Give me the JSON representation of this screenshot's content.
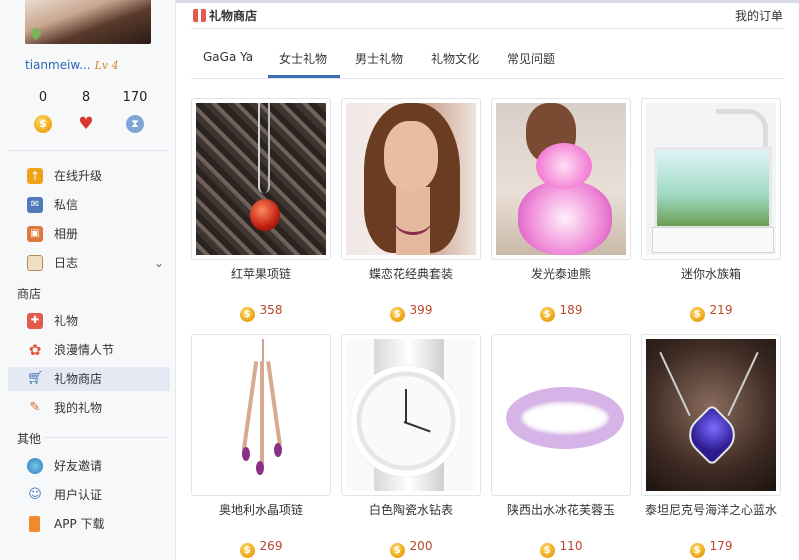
{
  "user": {
    "name": "tianmeiw...",
    "level": "Lv 4",
    "stats": [
      {
        "value": "0",
        "icon": "coin-icon"
      },
      {
        "value": "8",
        "icon": "heart-icon"
      },
      {
        "value": "170",
        "icon": "hourglass-icon"
      }
    ]
  },
  "sidebar": {
    "items_top": [
      {
        "label": "在线升级",
        "icon": "upgrade-icon"
      },
      {
        "label": "私信",
        "icon": "mail-icon"
      },
      {
        "label": "相册",
        "icon": "album-icon"
      },
      {
        "label": "日志",
        "icon": "journal-icon"
      }
    ],
    "section_shop": "商店",
    "items_shop": [
      {
        "label": "礼物",
        "icon": "gift-icon"
      },
      {
        "label": "浪漫情人节",
        "icon": "flower-icon"
      },
      {
        "label": "礼物商店",
        "icon": "cart-icon"
      },
      {
        "label": "我的礼物",
        "icon": "brush-icon"
      }
    ],
    "section_other": "其他",
    "items_other": [
      {
        "label": "好友邀请",
        "icon": "globe-icon"
      },
      {
        "label": "用户认证",
        "icon": "verified-user-icon"
      },
      {
        "label": "APP 下载",
        "icon": "phone-icon"
      }
    ],
    "active_item": "礼物商店"
  },
  "header": {
    "title": "礼物商店",
    "my_orders": "我的订单"
  },
  "tabs": [
    {
      "label": "GaGa Ya"
    },
    {
      "label": "女士礼物"
    },
    {
      "label": "男士礼物"
    },
    {
      "label": "礼物文化"
    },
    {
      "label": "常见问题"
    }
  ],
  "active_tab": "女士礼物",
  "products": [
    {
      "name": "红苹果项链",
      "price": "358"
    },
    {
      "name": "蝶恋花经典套装",
      "price": "399"
    },
    {
      "name": "发光泰迪熊",
      "price": "189"
    },
    {
      "name": "迷你水族箱",
      "price": "219"
    },
    {
      "name": "奥地利水晶项链",
      "price": "269"
    },
    {
      "name": "白色陶瓷水钻表",
      "price": "200"
    },
    {
      "name": "陕西出水冰花芙蓉玉",
      "price": "110"
    },
    {
      "name": "泰坦尼克号海洋之心蓝水",
      "price": "179"
    }
  ],
  "colors": {
    "accent": "#3b6fb6",
    "price": "#b9462a",
    "active_nav_bg": "#e4e9f4",
    "coin": "#f0a514"
  }
}
